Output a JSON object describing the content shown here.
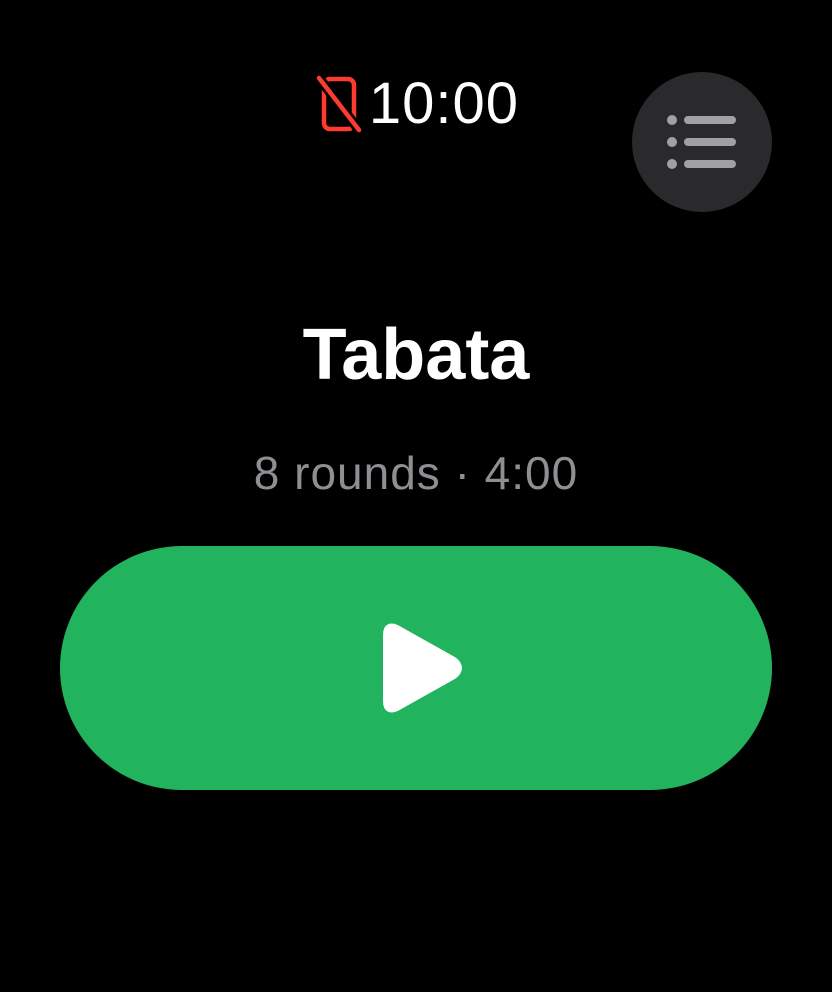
{
  "status_bar": {
    "time": "10:00",
    "disconnected_icon": "iphone-disconnected-icon",
    "disconnected_color": "#ff3b30"
  },
  "menu": {
    "icon": "list-icon",
    "background": "#2a2a2c"
  },
  "workout": {
    "title": "Tabata",
    "subtitle": "8 rounds · 4:00"
  },
  "start_button": {
    "icon": "play-icon",
    "color": "#22b35e"
  }
}
